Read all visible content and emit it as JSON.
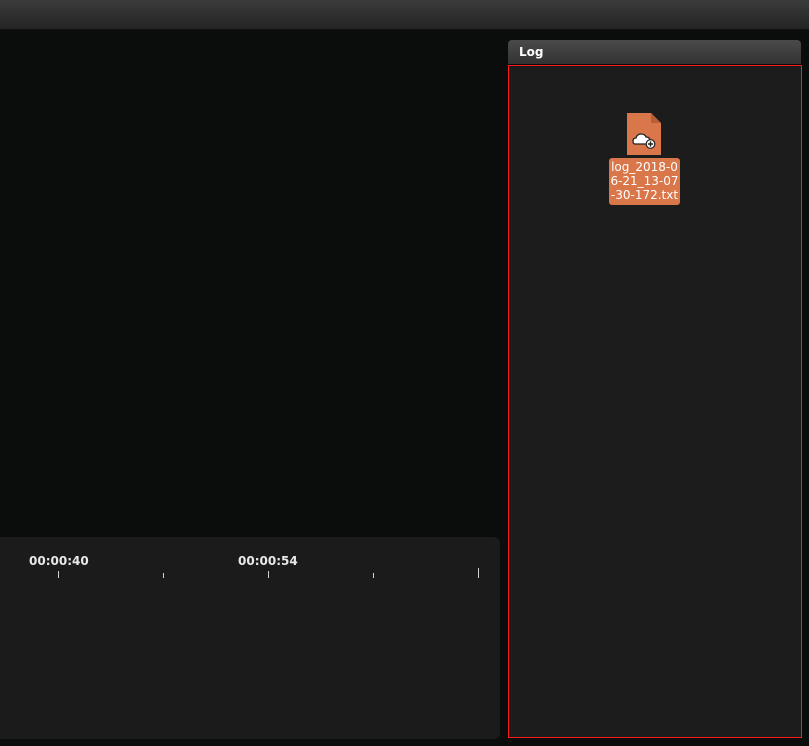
{
  "viewer": {
    "timeline": {
      "labels": [
        "00:00:40",
        "00:00:54"
      ]
    }
  },
  "log_panel": {
    "title": "Log",
    "files": [
      {
        "name": "log_2018-06-21_13-07-30-172.txt",
        "icon": "cloud-upload-file-icon"
      }
    ]
  },
  "colors": {
    "file_accent": "#d9764a",
    "selection_border": "#ff1a1a"
  }
}
